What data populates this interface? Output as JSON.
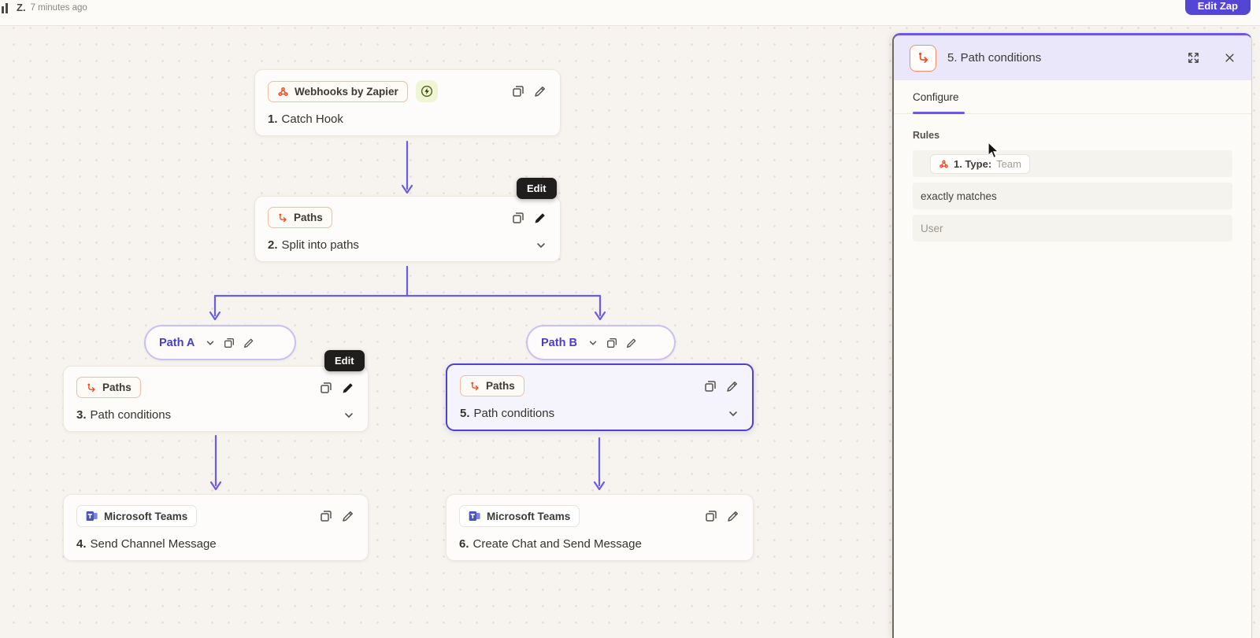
{
  "topbar": {
    "status_left": "Z.",
    "status_time": "7 minutes ago",
    "edit_zap": "Edit Zap"
  },
  "tooltip": {
    "label": "Edit"
  },
  "canvas": {
    "nodes": [
      {
        "app": "Webhooks by Zapier",
        "num": "1.",
        "title": "Catch Hook"
      },
      {
        "app": "Paths",
        "num": "2.",
        "title": "Split into paths"
      },
      {
        "app": "Paths",
        "num": "3.",
        "title": "Path conditions"
      },
      {
        "app": "Microsoft Teams",
        "num": "4.",
        "title": "Send Channel Message"
      },
      {
        "app": "Paths",
        "num": "5.",
        "title": "Path conditions"
      },
      {
        "app": "Microsoft Teams",
        "num": "6.",
        "title": "Create Chat and Send Message"
      }
    ],
    "path_labels": [
      "Path A",
      "Path B"
    ]
  },
  "panel": {
    "title": "5. Path conditions",
    "tab": "Configure",
    "rules_label": "Rules",
    "rule_field_prefix": "1. Type:",
    "rule_field_value": "Team",
    "rule_operator": "exactly matches",
    "rule_value": "User"
  },
  "colors": {
    "accent_purple": "#695be0",
    "accent_orange": "#f24d21",
    "selected_border": "#4f40cf",
    "edit_zap_bg": "#5346d4"
  }
}
